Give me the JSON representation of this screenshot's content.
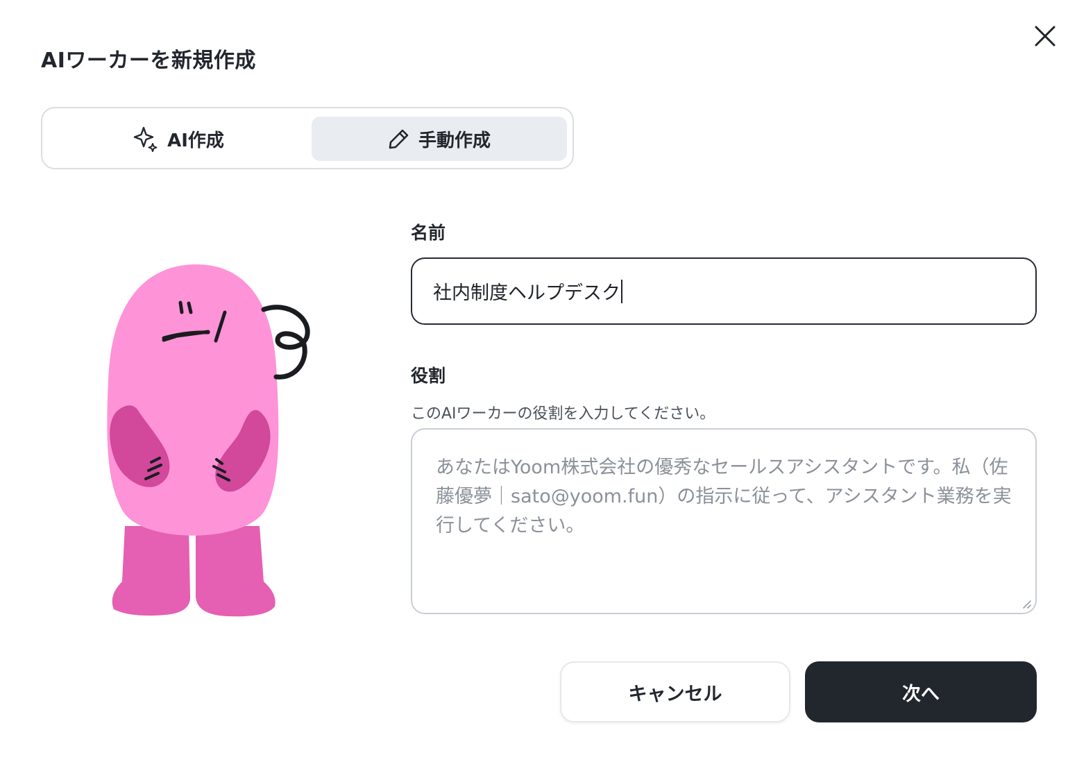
{
  "dialog": {
    "title": "AIワーカーを新規作成",
    "close_icon": "close-icon"
  },
  "mode_tabs": [
    {
      "label": "AI作成",
      "icon": "sparkle-icon",
      "selected": false
    },
    {
      "label": "手動作成",
      "icon": "pencil-icon",
      "selected": true
    }
  ],
  "form": {
    "name_label": "名前",
    "name_value": "社内制度ヘルプデスク",
    "role_label": "役割",
    "role_help": "このAIワーカーの役割を入力してください。",
    "role_placeholder": "あなたはYoom株式会社の優秀なセールスアシスタントです。私（佐藤優夢｜sato@yoom.fun）の指示に従って、アシスタント業務を実行してください。"
  },
  "buttons": {
    "cancel_label": "キャンセル",
    "next_label": "次へ"
  },
  "colors": {
    "mascot_body": "#fe93d8",
    "mascot_dark": "#d2489b",
    "mascot_legs": "#e55fb2",
    "primary_button": "#22262d",
    "selected_tab_bg": "#e9ecf0"
  }
}
